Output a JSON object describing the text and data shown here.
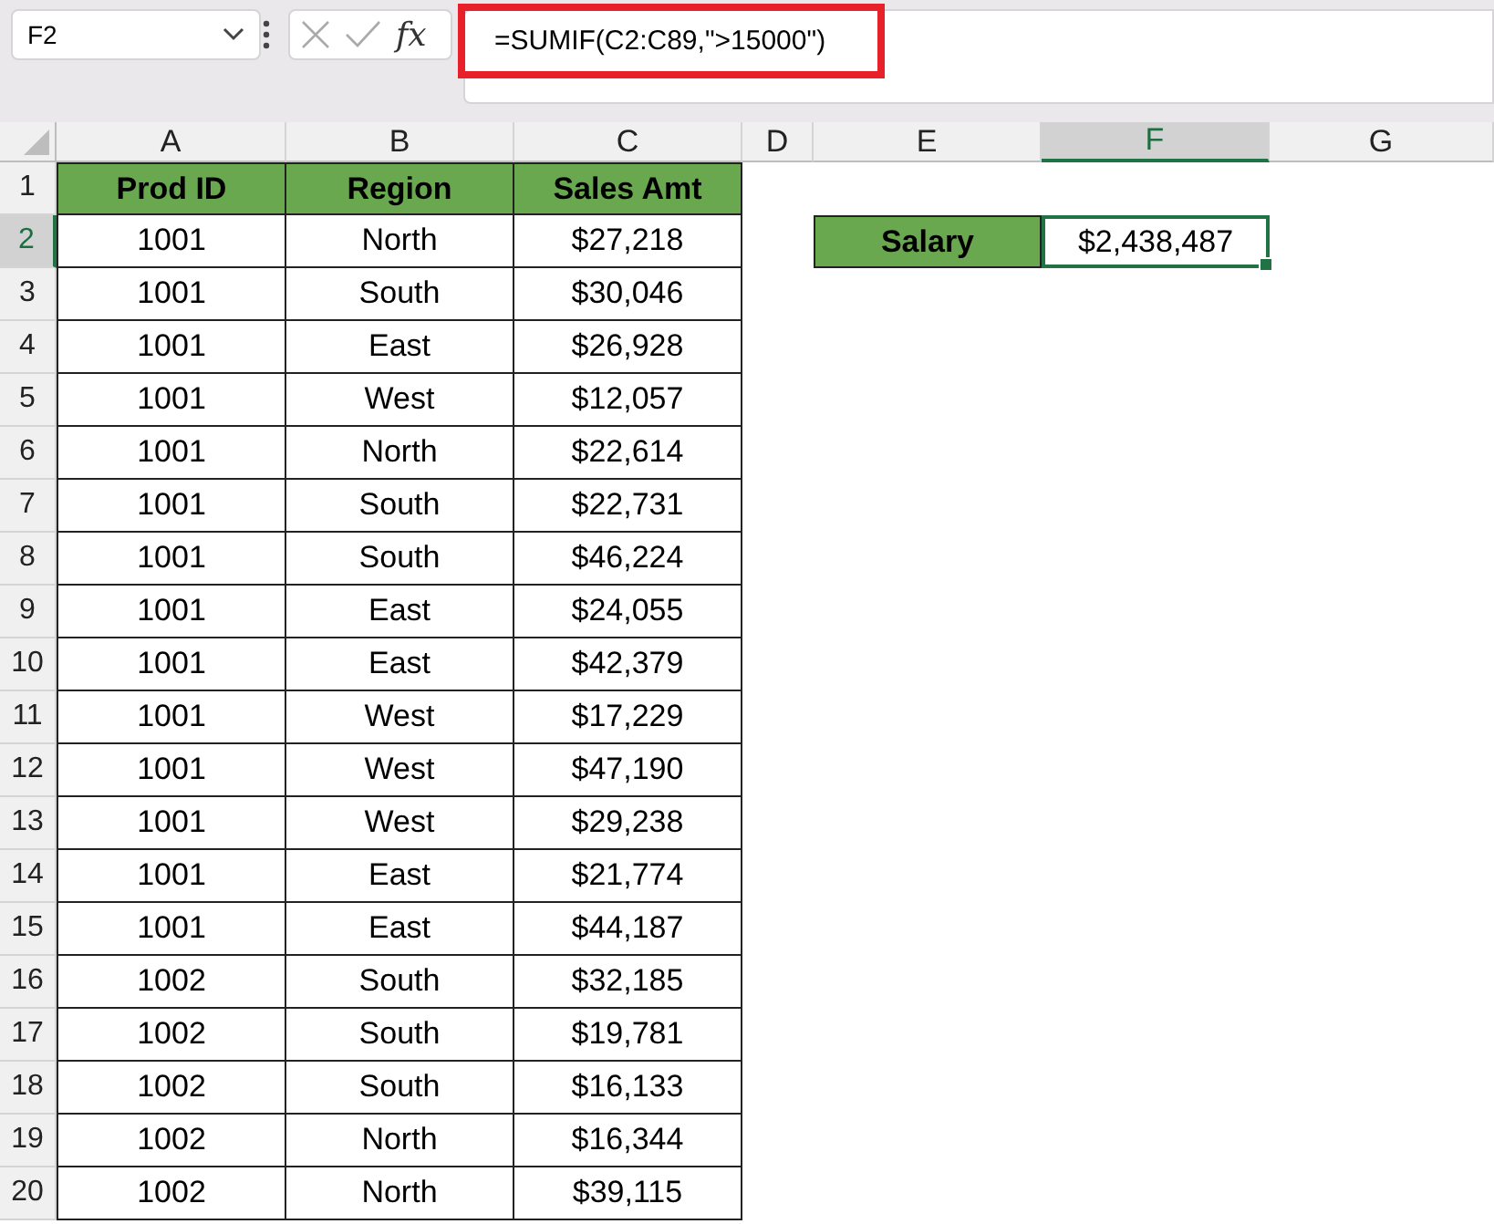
{
  "formula_bar": {
    "name_box": "F2",
    "function_label": "fx",
    "formula": "=SUMIF(C2:C89,\">15000\")",
    "highlighted": true
  },
  "columns": [
    {
      "label": "A",
      "selected": false
    },
    {
      "label": "B",
      "selected": false
    },
    {
      "label": "C",
      "selected": false
    },
    {
      "label": "D",
      "selected": false
    },
    {
      "label": "E",
      "selected": false
    },
    {
      "label": "F",
      "selected": true
    },
    {
      "label": "G",
      "selected": false
    }
  ],
  "row_headers": [
    {
      "label": "1",
      "selected": false
    },
    {
      "label": "2",
      "selected": true
    },
    {
      "label": "3",
      "selected": false
    },
    {
      "label": "4",
      "selected": false
    },
    {
      "label": "5",
      "selected": false
    },
    {
      "label": "6",
      "selected": false
    },
    {
      "label": "7",
      "selected": false
    },
    {
      "label": "8",
      "selected": false
    },
    {
      "label": "9",
      "selected": false
    },
    {
      "label": "10",
      "selected": false
    },
    {
      "label": "11",
      "selected": false
    },
    {
      "label": "12",
      "selected": false
    },
    {
      "label": "13",
      "selected": false
    },
    {
      "label": "14",
      "selected": false
    },
    {
      "label": "15",
      "selected": false
    },
    {
      "label": "16",
      "selected": false
    },
    {
      "label": "17",
      "selected": false
    },
    {
      "label": "18",
      "selected": false
    },
    {
      "label": "19",
      "selected": false
    },
    {
      "label": "20",
      "selected": false
    }
  ],
  "table": {
    "header": [
      "Prod ID",
      "Region",
      "Sales Amt"
    ],
    "rows": [
      [
        "1001",
        "North",
        "$27,218"
      ],
      [
        "1001",
        "South",
        "$30,046"
      ],
      [
        "1001",
        "East",
        "$26,928"
      ],
      [
        "1001",
        "West",
        "$12,057"
      ],
      [
        "1001",
        "North",
        "$22,614"
      ],
      [
        "1001",
        "South",
        "$22,731"
      ],
      [
        "1001",
        "South",
        "$46,224"
      ],
      [
        "1001",
        "East",
        "$24,055"
      ],
      [
        "1001",
        "East",
        "$42,379"
      ],
      [
        "1001",
        "West",
        "$17,229"
      ],
      [
        "1001",
        "West",
        "$47,190"
      ],
      [
        "1001",
        "West",
        "$29,238"
      ],
      [
        "1001",
        "East",
        "$21,774"
      ],
      [
        "1001",
        "East",
        "$44,187"
      ],
      [
        "1002",
        "South",
        "$32,185"
      ],
      [
        "1002",
        "South",
        "$19,781"
      ],
      [
        "1002",
        "South",
        "$16,133"
      ],
      [
        "1002",
        "North",
        "$16,344"
      ],
      [
        "1002",
        "North",
        "$39,115"
      ]
    ]
  },
  "summary": {
    "label": "Salary",
    "value": "$2,438,487",
    "selected": true
  }
}
